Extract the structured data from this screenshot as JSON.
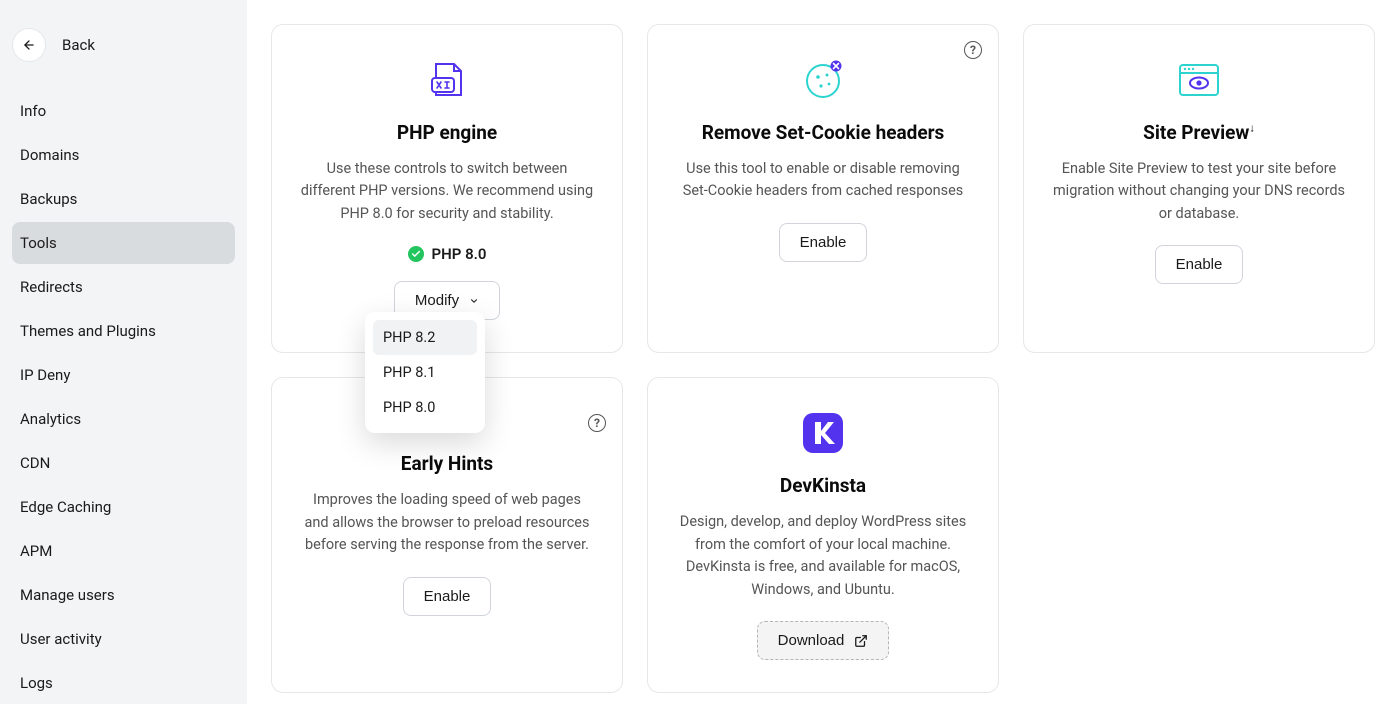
{
  "sidebar": {
    "back_label": "Back",
    "items": [
      {
        "label": "Info",
        "active": false
      },
      {
        "label": "Domains",
        "active": false
      },
      {
        "label": "Backups",
        "active": false
      },
      {
        "label": "Tools",
        "active": true
      },
      {
        "label": "Redirects",
        "active": false
      },
      {
        "label": "Themes and Plugins",
        "active": false
      },
      {
        "label": "IP Deny",
        "active": false
      },
      {
        "label": "Analytics",
        "active": false
      },
      {
        "label": "CDN",
        "active": false
      },
      {
        "label": "Edge Caching",
        "active": false
      },
      {
        "label": "APM",
        "active": false
      },
      {
        "label": "Manage users",
        "active": false
      },
      {
        "label": "User activity",
        "active": false
      },
      {
        "label": "Logs",
        "active": false
      }
    ]
  },
  "cards": {
    "php_engine": {
      "title": "PHP engine",
      "description": "Use these controls to switch between different PHP versions. We recommend using PHP 8.0 for security and stability.",
      "status_text": "PHP 8.0",
      "modify_label": "Modify",
      "dropdown_options": [
        "PHP 8.2",
        "PHP 8.1",
        "PHP 8.0"
      ],
      "dropdown_highlighted_index": 0
    },
    "remove_cookie": {
      "title": "Remove Set-Cookie headers",
      "description": "Use this tool to enable or disable removing Set-Cookie headers from cached responses",
      "enable_label": "Enable"
    },
    "site_preview": {
      "title": "Site Preview",
      "title_suffix": "↓",
      "description": "Enable Site Preview to test your site before migration without changing your DNS records or database.",
      "enable_label": "Enable"
    },
    "early_hints": {
      "title": "Early Hints",
      "description": "Improves the loading speed of web pages and allows the browser to preload resources before serving the response from the server.",
      "enable_label": "Enable"
    },
    "devkinsta": {
      "title": "DevKinsta",
      "description": "Design, develop, and deploy WordPress sites from the comfort of your local machine. DevKinsta is free, and available for macOS, Windows, and Ubuntu.",
      "download_label": "Download"
    }
  },
  "colors": {
    "accent_purple": "#5333ed",
    "teal": "#2dd4cf",
    "success": "#22c55e"
  }
}
